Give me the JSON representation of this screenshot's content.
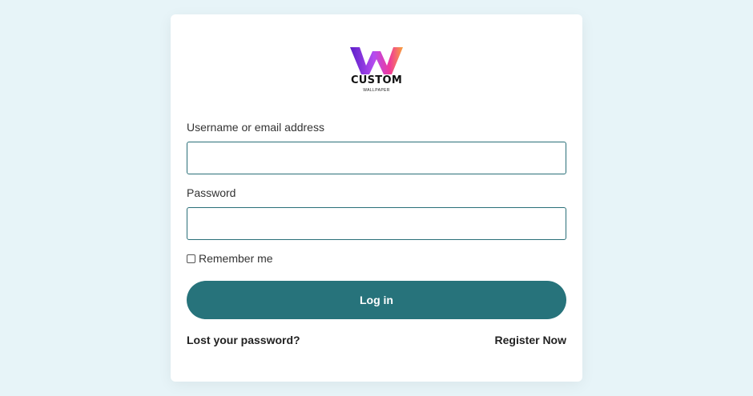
{
  "logo": {
    "title": "CUSTOM",
    "subtitle": "WALLPAPER",
    "icon": "w-logo-icon",
    "colors": [
      "#5b1ec9",
      "#b44cf0",
      "#f0399a",
      "#f8a23c"
    ]
  },
  "form": {
    "username_label": "Username or email address",
    "username_value": "",
    "password_label": "Password",
    "password_value": "",
    "remember_label": "Remember me",
    "remember_checked": false,
    "login_label": "Log in"
  },
  "links": {
    "lost_password": "Lost your password?",
    "register": "Register Now"
  },
  "colors": {
    "background": "#e7f4f8",
    "accent": "#27737b",
    "input_border": "#2a6f78"
  }
}
